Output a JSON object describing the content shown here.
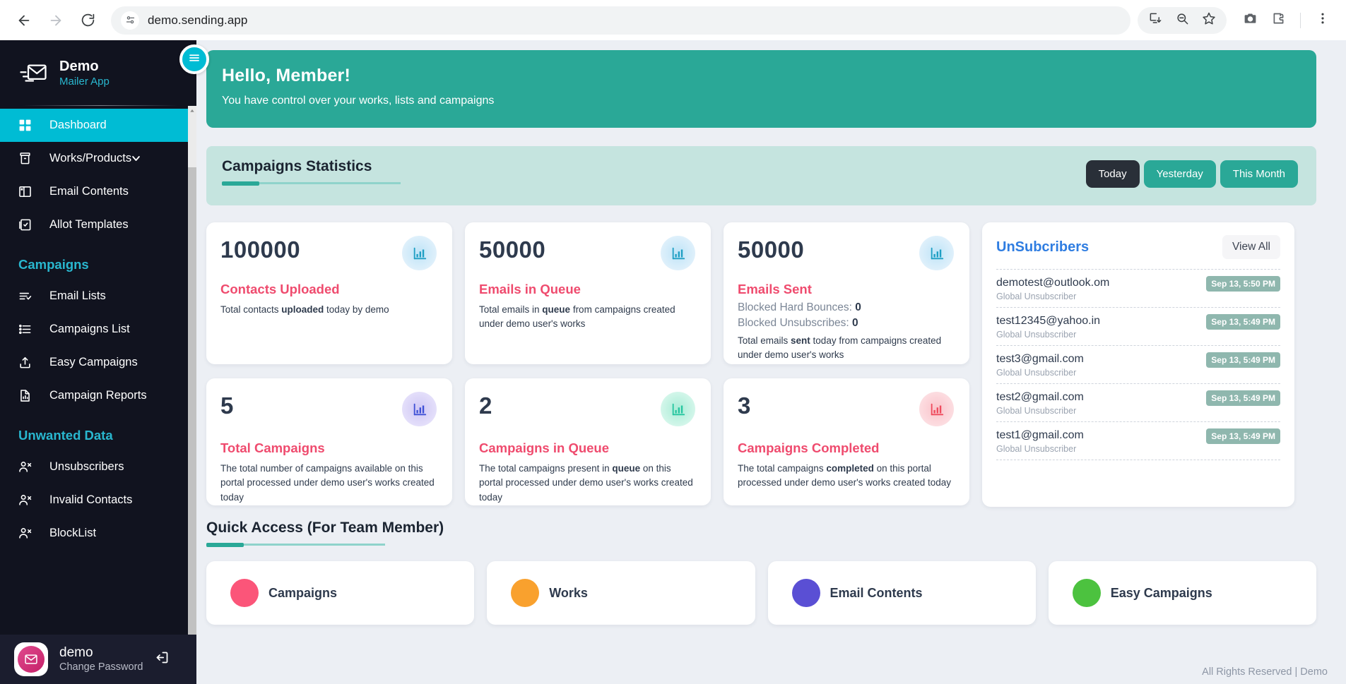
{
  "browser": {
    "url": "demo.sending.app",
    "back_icon": "back-arrow-icon",
    "forward_icon": "forward-arrow-icon",
    "reload_icon": "reload-icon",
    "site_info_icon": "site-info-icon",
    "install_icon": "install-app-icon",
    "zoom_out_icon": "zoom-out-icon",
    "bookmark_icon": "star-icon",
    "screenshot_icon": "camera-icon",
    "extensions_icon": "extensions-puzzle-icon",
    "menu_icon": "three-dot-menu-icon"
  },
  "sidebar": {
    "brand": "Demo",
    "brand_sub": "Mailer App",
    "items": [
      {
        "label": "Dashboard",
        "icon": "grid-icon",
        "active": true
      },
      {
        "label": "Works/Products",
        "icon": "box-icon",
        "active": false,
        "caret": true
      },
      {
        "label": "Email Contents",
        "icon": "layout-icon",
        "active": false
      },
      {
        "label": "Allot Templates",
        "icon": "template-check-icon",
        "active": false
      }
    ],
    "group_campaigns": "Campaigns",
    "campaign_items": [
      {
        "label": "Email Lists",
        "icon": "list-check-icon"
      },
      {
        "label": "Campaigns List",
        "icon": "list-icon"
      },
      {
        "label": "Easy Campaigns",
        "icon": "upload-icon"
      },
      {
        "label": "Campaign Reports",
        "icon": "report-file-icon"
      }
    ],
    "group_unwanted": "Unwanted Data",
    "unwanted_items": [
      {
        "label": "Unsubscribers",
        "icon": "user-remove-icon"
      },
      {
        "label": "Invalid Contacts",
        "icon": "user-remove-icon"
      },
      {
        "label": "BlockList",
        "icon": "user-remove-icon"
      }
    ],
    "footer_user": "demo",
    "footer_action": "Change Password",
    "logout_icon": "logout-icon",
    "avatar_icon": "envelope-avatar-icon",
    "hamburger_icon": "hamburger-menu-icon"
  },
  "hero": {
    "greeting": "Hello, Member!",
    "subtitle": "You have control over your works, lists and campaigns"
  },
  "stats_header": {
    "title": "Campaigns Statistics",
    "segments": [
      {
        "label": "Today",
        "selected": true
      },
      {
        "label": "Yesterday",
        "selected": false
      },
      {
        "label": "This Month",
        "selected": false
      }
    ]
  },
  "cards_row1": [
    {
      "value": "100000",
      "title": "Contacts Uploaded",
      "desc_pre": "Total contacts ",
      "desc_bold": "uploaded",
      "desc_post": " today by demo",
      "icon": "bar-chart-icon",
      "bubble_color": "#cde9f8",
      "icon_color": "#1f9fc4"
    },
    {
      "value": "50000",
      "title": "Emails in Queue",
      "desc_pre": "Total emails in ",
      "desc_bold": "queue",
      "desc_post": " from campaigns created under demo user's works",
      "icon": "bar-chart-icon",
      "bubble_color": "#cde9f8",
      "icon_color": "#1f9fc4"
    },
    {
      "value": "50000",
      "title": "Emails Sent",
      "sub1_label": "Blocked Hard Bounces: ",
      "sub1_value": "0",
      "sub2_label": "Blocked Unsubscribes: ",
      "sub2_value": "0",
      "desc_pre": "Total emails ",
      "desc_bold": "sent",
      "desc_post": " today from campaigns created under demo user's works",
      "icon": "bar-chart-icon",
      "bubble_color": "#cde9f8",
      "icon_color": "#1f9fc4"
    }
  ],
  "cards_row2": [
    {
      "value": "5",
      "title": "Total Campaigns",
      "desc_pre": "The total number of campaigns available on this portal processed under demo user's works created today",
      "desc_bold": "",
      "desc_post": "",
      "icon": "bar-chart-icon",
      "bubble_color": "#ddd8f7",
      "icon_color": "#3f51d6"
    },
    {
      "value": "2",
      "title": "Campaigns in Queue",
      "desc_pre": "The total campaigns present in ",
      "desc_bold": "queue",
      "desc_post": " on this portal processed under demo user's works created today",
      "icon": "bar-chart-icon",
      "bubble_color": "#bdf0de",
      "icon_color": "#26c6a0"
    },
    {
      "value": "3",
      "title": "Campaigns Completed",
      "desc_pre": "The total campaigns ",
      "desc_bold": "completed",
      "desc_post": " on this portal processed under demo user's works created today",
      "icon": "bar-chart-icon",
      "bubble_color": "#fbd5da",
      "icon_color": "#ef4b5e"
    }
  ],
  "unsubscribers": {
    "title": "UnSubcribers",
    "view_all": "View All",
    "rows": [
      {
        "email": "demotest@outlook.om",
        "kind": "Global Unsubscriber",
        "date": "Sep 13, 5:50 PM"
      },
      {
        "email": "test12345@yahoo.in",
        "kind": "Global Unsubscriber",
        "date": "Sep 13, 5:49 PM"
      },
      {
        "email": "test3@gmail.com",
        "kind": "Global Unsubscriber",
        "date": "Sep 13, 5:49 PM"
      },
      {
        "email": "test2@gmail.com",
        "kind": "Global Unsubscriber",
        "date": "Sep 13, 5:49 PM"
      },
      {
        "email": "test1@gmail.com",
        "kind": "Global Unsubscriber",
        "date": "Sep 13, 5:49 PM"
      }
    ]
  },
  "quick_access": {
    "title": "Quick Access (For Team Member)",
    "cards": [
      {
        "label": "Campaigns",
        "color": "#fb5579"
      },
      {
        "label": "Works",
        "color": "#f9a game",
        "color_hex": "#f9a12e"
      },
      {
        "label": "Email Contents",
        "color": "#5a4fd4"
      },
      {
        "label": "Easy Campaigns",
        "color": "#4cc23f"
      }
    ]
  },
  "footer": {
    "text": "All Rights Reserved | Demo"
  },
  "colors": {
    "accent_cyan": "#00bcd4",
    "teal": "#2aa897",
    "pink": "#ef4b6e",
    "sidebar_bg": "#11131f",
    "page_bg": "#eceff4"
  }
}
